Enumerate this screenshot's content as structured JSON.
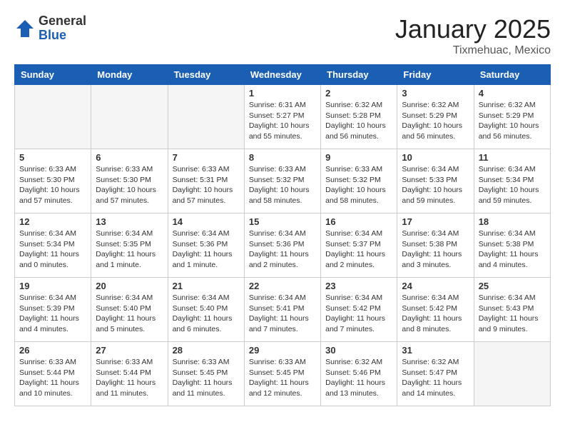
{
  "header": {
    "logo_general": "General",
    "logo_blue": "Blue",
    "month_title": "January 2025",
    "location": "Tixmehuac, Mexico"
  },
  "weekdays": [
    "Sunday",
    "Monday",
    "Tuesday",
    "Wednesday",
    "Thursday",
    "Friday",
    "Saturday"
  ],
  "weeks": [
    [
      {
        "day": "",
        "info": ""
      },
      {
        "day": "",
        "info": ""
      },
      {
        "day": "",
        "info": ""
      },
      {
        "day": "1",
        "info": "Sunrise: 6:31 AM\nSunset: 5:27 PM\nDaylight: 10 hours\nand 55 minutes."
      },
      {
        "day": "2",
        "info": "Sunrise: 6:32 AM\nSunset: 5:28 PM\nDaylight: 10 hours\nand 56 minutes."
      },
      {
        "day": "3",
        "info": "Sunrise: 6:32 AM\nSunset: 5:29 PM\nDaylight: 10 hours\nand 56 minutes."
      },
      {
        "day": "4",
        "info": "Sunrise: 6:32 AM\nSunset: 5:29 PM\nDaylight: 10 hours\nand 56 minutes."
      }
    ],
    [
      {
        "day": "5",
        "info": "Sunrise: 6:33 AM\nSunset: 5:30 PM\nDaylight: 10 hours\nand 57 minutes."
      },
      {
        "day": "6",
        "info": "Sunrise: 6:33 AM\nSunset: 5:30 PM\nDaylight: 10 hours\nand 57 minutes."
      },
      {
        "day": "7",
        "info": "Sunrise: 6:33 AM\nSunset: 5:31 PM\nDaylight: 10 hours\nand 57 minutes."
      },
      {
        "day": "8",
        "info": "Sunrise: 6:33 AM\nSunset: 5:32 PM\nDaylight: 10 hours\nand 58 minutes."
      },
      {
        "day": "9",
        "info": "Sunrise: 6:33 AM\nSunset: 5:32 PM\nDaylight: 10 hours\nand 58 minutes."
      },
      {
        "day": "10",
        "info": "Sunrise: 6:34 AM\nSunset: 5:33 PM\nDaylight: 10 hours\nand 59 minutes."
      },
      {
        "day": "11",
        "info": "Sunrise: 6:34 AM\nSunset: 5:34 PM\nDaylight: 10 hours\nand 59 minutes."
      }
    ],
    [
      {
        "day": "12",
        "info": "Sunrise: 6:34 AM\nSunset: 5:34 PM\nDaylight: 11 hours\nand 0 minutes."
      },
      {
        "day": "13",
        "info": "Sunrise: 6:34 AM\nSunset: 5:35 PM\nDaylight: 11 hours\nand 1 minute."
      },
      {
        "day": "14",
        "info": "Sunrise: 6:34 AM\nSunset: 5:36 PM\nDaylight: 11 hours\nand 1 minute."
      },
      {
        "day": "15",
        "info": "Sunrise: 6:34 AM\nSunset: 5:36 PM\nDaylight: 11 hours\nand 2 minutes."
      },
      {
        "day": "16",
        "info": "Sunrise: 6:34 AM\nSunset: 5:37 PM\nDaylight: 11 hours\nand 2 minutes."
      },
      {
        "day": "17",
        "info": "Sunrise: 6:34 AM\nSunset: 5:38 PM\nDaylight: 11 hours\nand 3 minutes."
      },
      {
        "day": "18",
        "info": "Sunrise: 6:34 AM\nSunset: 5:38 PM\nDaylight: 11 hours\nand 4 minutes."
      }
    ],
    [
      {
        "day": "19",
        "info": "Sunrise: 6:34 AM\nSunset: 5:39 PM\nDaylight: 11 hours\nand 4 minutes."
      },
      {
        "day": "20",
        "info": "Sunrise: 6:34 AM\nSunset: 5:40 PM\nDaylight: 11 hours\nand 5 minutes."
      },
      {
        "day": "21",
        "info": "Sunrise: 6:34 AM\nSunset: 5:40 PM\nDaylight: 11 hours\nand 6 minutes."
      },
      {
        "day": "22",
        "info": "Sunrise: 6:34 AM\nSunset: 5:41 PM\nDaylight: 11 hours\nand 7 minutes."
      },
      {
        "day": "23",
        "info": "Sunrise: 6:34 AM\nSunset: 5:42 PM\nDaylight: 11 hours\nand 7 minutes."
      },
      {
        "day": "24",
        "info": "Sunrise: 6:34 AM\nSunset: 5:42 PM\nDaylight: 11 hours\nand 8 minutes."
      },
      {
        "day": "25",
        "info": "Sunrise: 6:34 AM\nSunset: 5:43 PM\nDaylight: 11 hours\nand 9 minutes."
      }
    ],
    [
      {
        "day": "26",
        "info": "Sunrise: 6:33 AM\nSunset: 5:44 PM\nDaylight: 11 hours\nand 10 minutes."
      },
      {
        "day": "27",
        "info": "Sunrise: 6:33 AM\nSunset: 5:44 PM\nDaylight: 11 hours\nand 11 minutes."
      },
      {
        "day": "28",
        "info": "Sunrise: 6:33 AM\nSunset: 5:45 PM\nDaylight: 11 hours\nand 11 minutes."
      },
      {
        "day": "29",
        "info": "Sunrise: 6:33 AM\nSunset: 5:45 PM\nDaylight: 11 hours\nand 12 minutes."
      },
      {
        "day": "30",
        "info": "Sunrise: 6:32 AM\nSunset: 5:46 PM\nDaylight: 11 hours\nand 13 minutes."
      },
      {
        "day": "31",
        "info": "Sunrise: 6:32 AM\nSunset: 5:47 PM\nDaylight: 11 hours\nand 14 minutes."
      },
      {
        "day": "",
        "info": ""
      }
    ]
  ]
}
